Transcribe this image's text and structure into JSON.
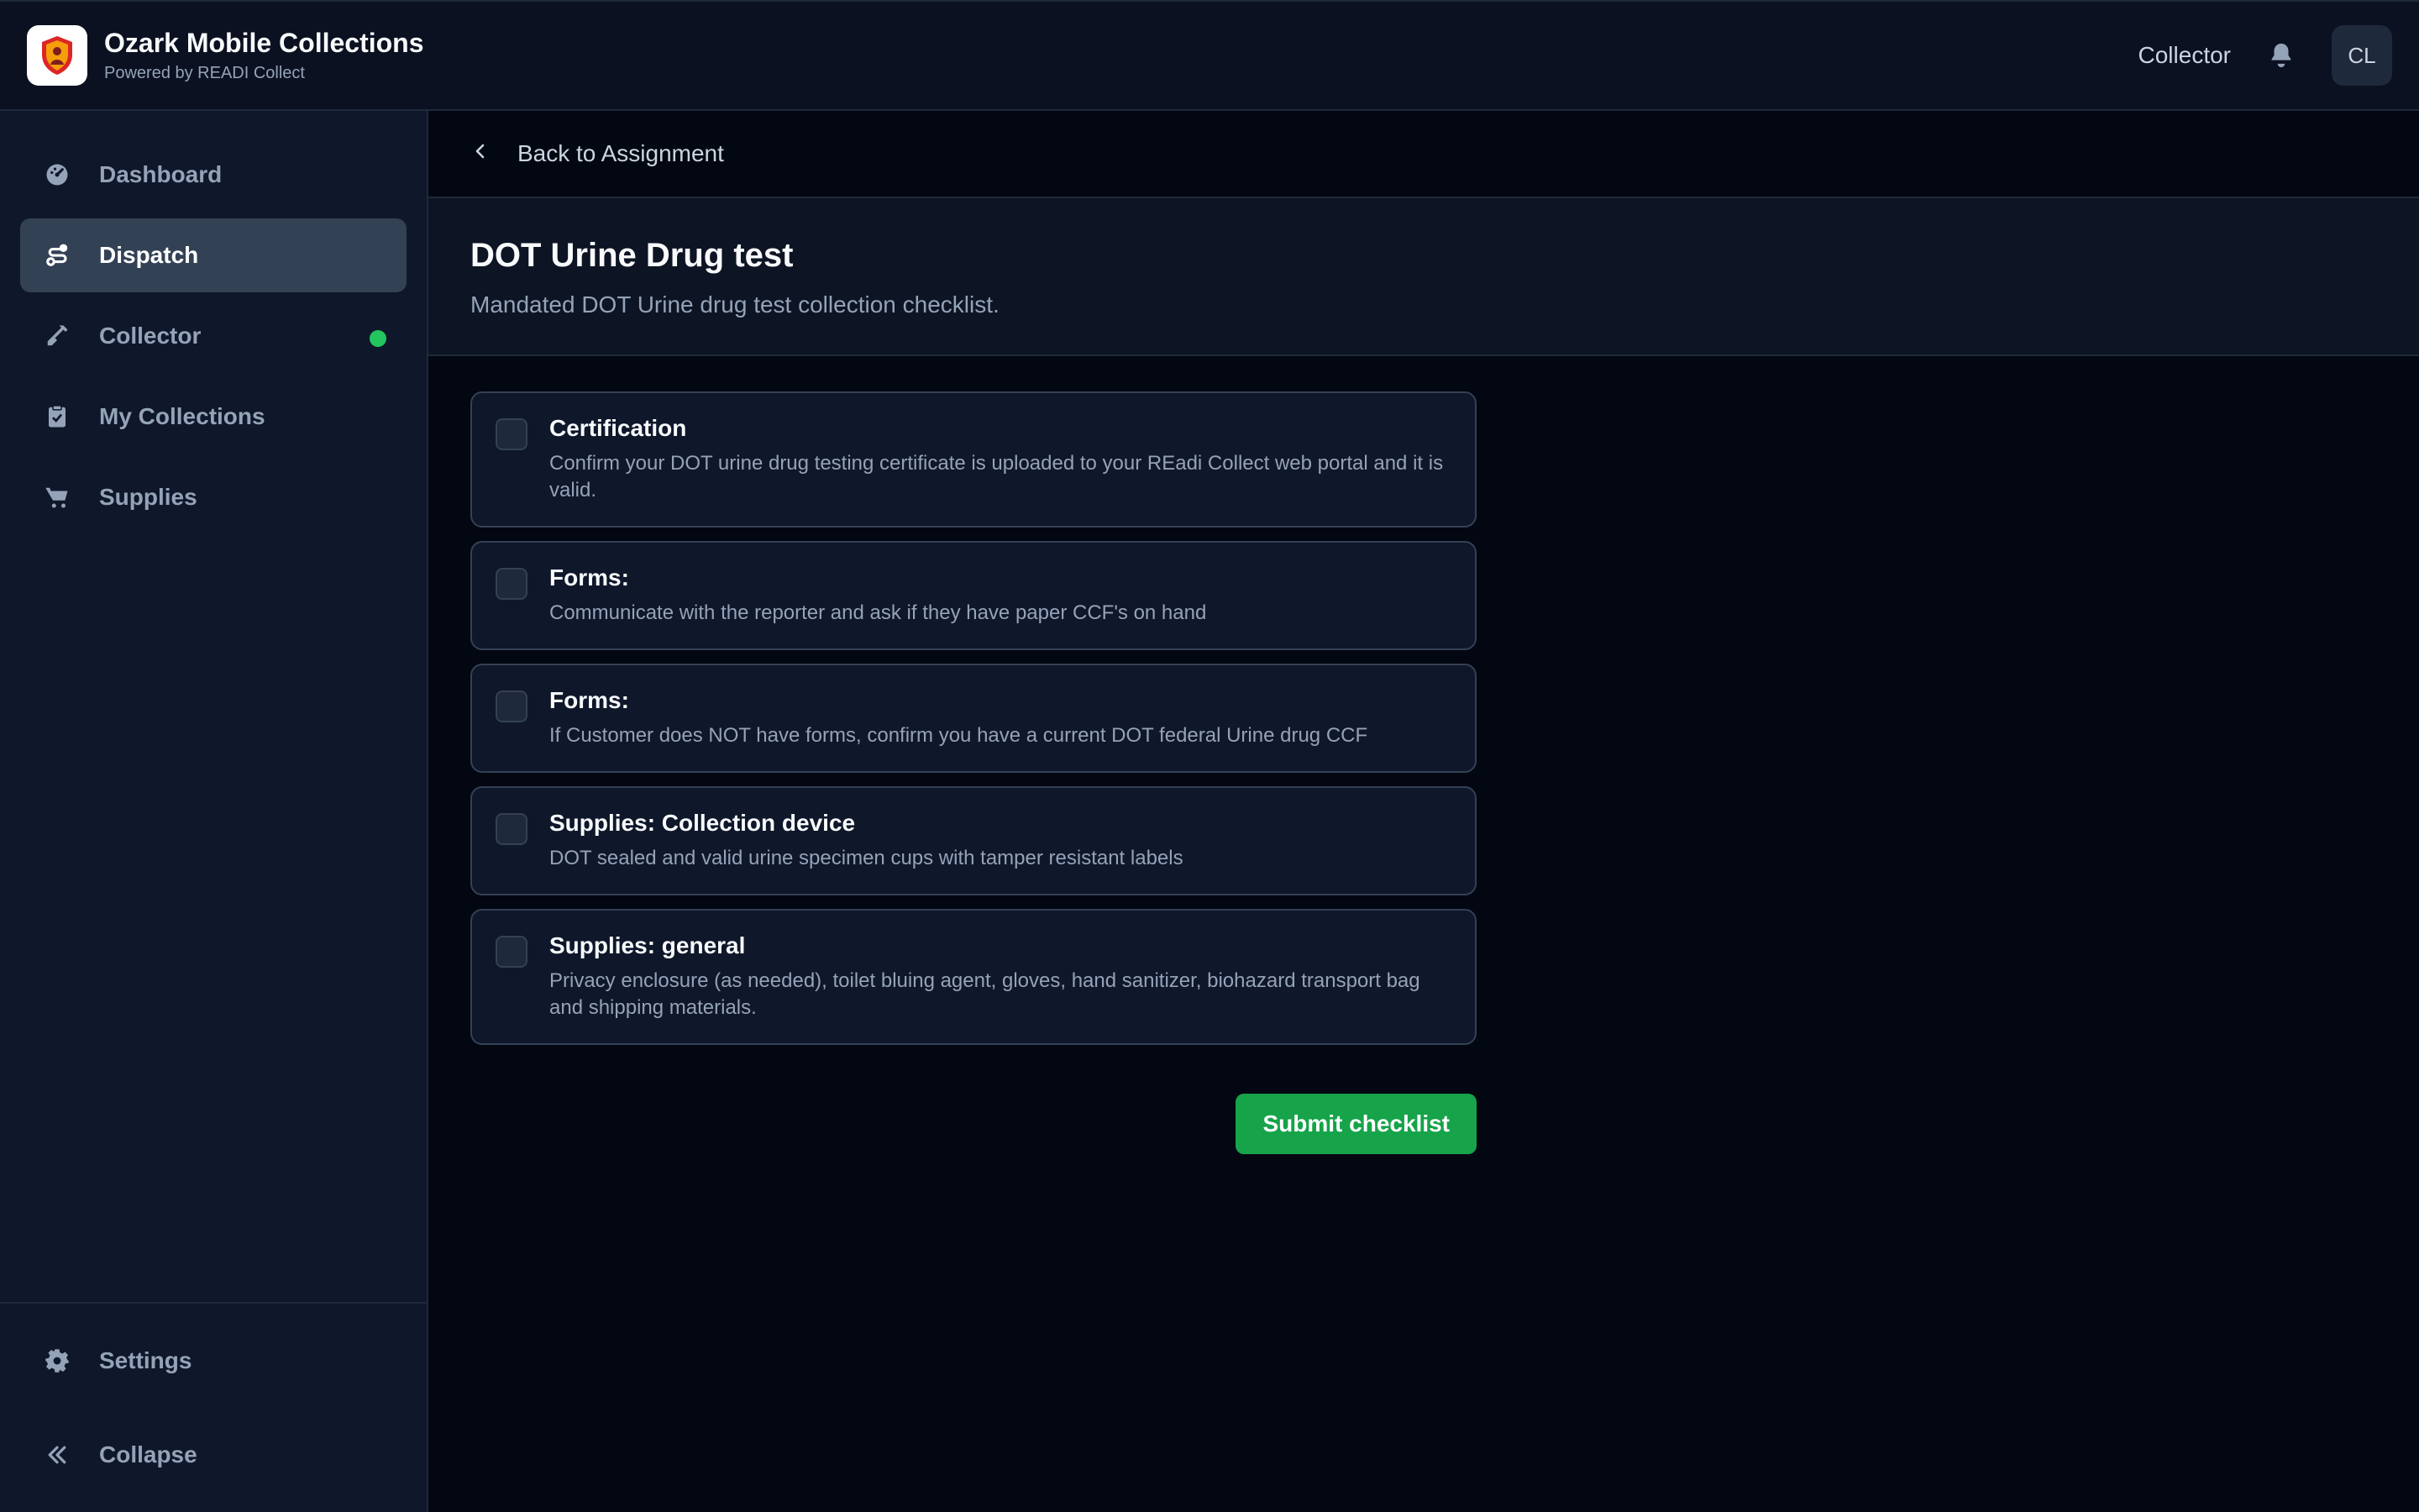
{
  "header": {
    "app_title": "Ozark Mobile Collections",
    "app_subtitle": "Powered by READI Collect",
    "role_label": "Collector",
    "avatar_initials": "CL"
  },
  "sidebar": {
    "items": [
      {
        "label": "Dashboard",
        "icon": "gauge-icon",
        "active": false
      },
      {
        "label": "Dispatch",
        "icon": "route-icon",
        "active": true
      },
      {
        "label": "Collector",
        "icon": "syringe-icon",
        "active": false,
        "status": "online"
      },
      {
        "label": "My Collections",
        "icon": "clipboard-check-icon",
        "active": false
      },
      {
        "label": "Supplies",
        "icon": "cart-icon",
        "active": false
      }
    ],
    "bottom": [
      {
        "label": "Settings",
        "icon": "gear-icon"
      },
      {
        "label": "Collapse",
        "icon": "double-chevron-left-icon"
      }
    ]
  },
  "main": {
    "back_label": "Back to Assignment",
    "title": "DOT Urine Drug test",
    "description": "Mandated DOT Urine drug test collection checklist.",
    "checklist": [
      {
        "title": "Certification",
        "description": "Confirm your DOT urine drug testing certificate is uploaded to your REadi Collect web portal and it is valid.",
        "checked": false
      },
      {
        "title": "Forms:",
        "description": "Communicate with the reporter and ask if they have paper CCF's on hand",
        "checked": false
      },
      {
        "title": "Forms:",
        "description": "If Customer does NOT have forms, confirm you have a current DOT federal Urine drug CCF",
        "checked": false
      },
      {
        "title": "Supplies: Collection device",
        "description": "DOT sealed and valid urine specimen cups with tamper resistant labels",
        "checked": false
      },
      {
        "title": "Supplies: general",
        "description": "Privacy enclosure (as needed), toilet bluing agent, gloves, hand sanitizer, biohazard transport bag and shipping materials.",
        "checked": false
      }
    ],
    "submit_label": "Submit checklist"
  },
  "colors": {
    "accent_green": "#16a34a",
    "status_online": "#22c55e",
    "background": "#030712",
    "sidebar": "#0f172a"
  }
}
